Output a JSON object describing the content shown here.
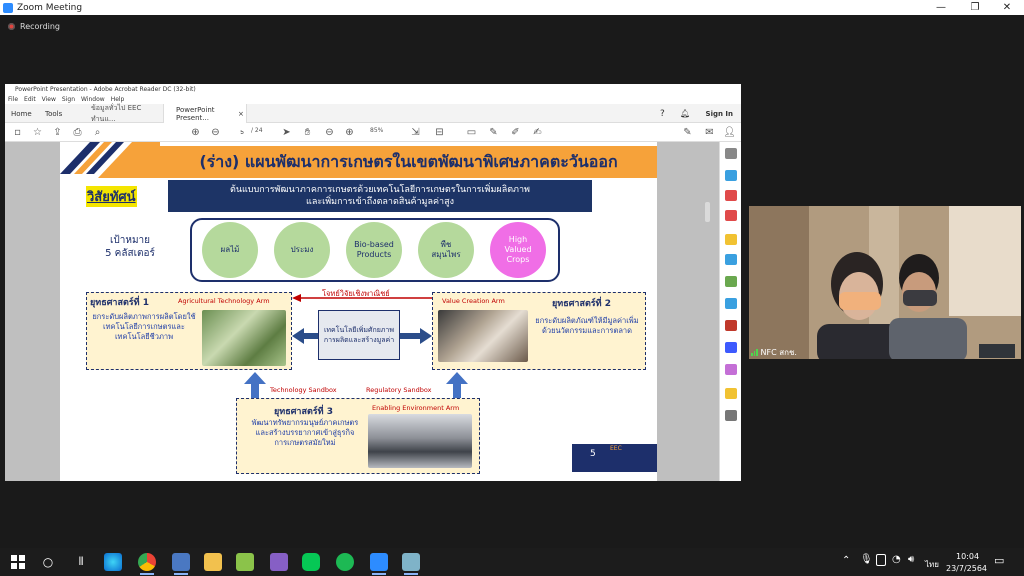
{
  "zoom": {
    "title": "Zoom Meeting",
    "recording": "Recording",
    "controls": {
      "minimize": "—",
      "maximize": "❐",
      "close": "✕"
    }
  },
  "acrobat": {
    "title": "PowerPoint Presentation - Adobe Acrobat Reader DC (32-bit)",
    "menu": [
      "File",
      "Edit",
      "View",
      "Sign",
      "Window",
      "Help"
    ],
    "tabs": {
      "home": "Home",
      "tools": "Tools",
      "doc1": "ข้อมูลทั่วไป EEC ทำนแ...",
      "doc2": "PowerPoint Present..."
    },
    "sign_in": "Sign In",
    "page_current": "5",
    "page_total": "/ 24",
    "zoom_level": "85%"
  },
  "slide": {
    "title": "(ร่าง) แผนพัฒนาการเกษตรในเขตพัฒนาพิเศษภาคตะวันออก",
    "vision_label": "วิสัยทัศน์",
    "vision_line1": "ต้นแบบการพัฒนาภาคการเกษตรด้วยเทคโนโลยีการเกษตรในการเพิ่มผลิตภาพ",
    "vision_line2": "และเพิ่มการเข้าถึงตลาดสินค้ามูลค่าสูง",
    "goal_line1": "เป้าหมาย",
    "goal_line2": "5 คลัสเตอร์",
    "clusters": [
      {
        "label": "ผลไม้"
      },
      {
        "label": "ประมง"
      },
      {
        "label": "Bio-based Products"
      },
      {
        "label": "พืช สมุนไพร"
      },
      {
        "label": "High Valued Crops"
      }
    ],
    "strategy1": {
      "title": "ยุทธศาสตร์ที่ 1",
      "arm": "Agricultural Technology Arm",
      "desc": "ยกระดับผลิตภาพการผลิตโดยใช้เทคโนโลยีการเกษตรและเทคโนโลยีชีวภาพ"
    },
    "strategy2": {
      "title": "ยุทธศาสตร์ที่ 2",
      "arm": "Value Creation Arm",
      "desc": "ยกระดับผลิตภัณฑ์ให้มีมูลค่าเพิ่ม ด้วยนวัตกรรมและการตลาด"
    },
    "strategy3": {
      "title": "ยุทธศาสตร์ที่ 3",
      "arm": "Enabling Environment Arm",
      "desc": "พัฒนาทรัพยากรมนุษย์ภาคเกษตร และสร้างบรรยากาศเข้าสู่ธุรกิจการเกษตรสมัยใหม่"
    },
    "red_arrow_label": "โจทย์วิจัยเชิงพาณิชย์",
    "center_tech": "เทคโนโลยีเพิ่มศักยภาพการผลิตและสร้างมูลค่า",
    "sandbox_tech": "Technology Sandbox",
    "sandbox_reg": "Regulatory Sandbox",
    "page_number": "5",
    "logo_text": "EEC",
    "colors": {
      "navy": "#1d2f6b",
      "orange": "#f6a23a",
      "green": "#b5d99c",
      "pink": "#f06ee6",
      "red": "#c00000"
    }
  },
  "video": {
    "participant": "NFC สกช."
  },
  "taskbar": {
    "language": "ไทย",
    "time": "10:04",
    "date": "23/7/2564"
  }
}
